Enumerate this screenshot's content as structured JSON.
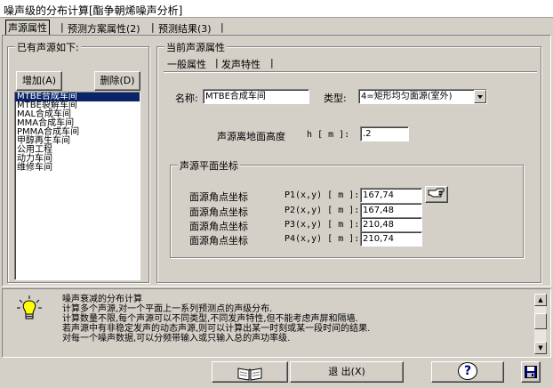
{
  "window": {
    "title": "噪声级的分布计算[酯争朝烯噪声分析]"
  },
  "tabs": [
    {
      "label": "声源属性"
    },
    {
      "label": "预测方案属性(2)"
    },
    {
      "label": "预测结果(3)"
    }
  ],
  "left": {
    "group_title": "已有声源如下:",
    "add_button": "增加(A)",
    "delete_button": "删除(D)",
    "sources": [
      "MTBE合成车间",
      "MTBE裂解车间",
      "MAL合成车间",
      "MMA合成车间",
      "PMMA合成车间",
      "甲醇再生车间",
      "公用工程",
      "动力车间",
      "维修车间"
    ],
    "selected_index": 0
  },
  "right": {
    "group_title": "当前声源属性",
    "subtabs": [
      "一般属性",
      "发声特性"
    ],
    "name_label": "名称:",
    "name_value": "MTBE合成车间",
    "type_label": "类型:",
    "type_value": "4=矩形均匀面源(室外)",
    "height_label": "声源离地面高度",
    "height_unit": "h [ m ]:",
    "height_value": ".2",
    "coords": {
      "group_title": "声源平面坐标",
      "rows": [
        {
          "label": "面源角点坐标",
          "unit": "P1(x,y) [ m ]:",
          "value": "167,74"
        },
        {
          "label": "面源角点坐标",
          "unit": "P2(x,y) [ m ]:",
          "value": "167,48"
        },
        {
          "label": "面源角点坐标",
          "unit": "P3(x,y) [ m ]:",
          "value": "210,48"
        },
        {
          "label": "面源角点坐标",
          "unit": "P4(x,y) [ m ]:",
          "value": "210,74"
        }
      ]
    }
  },
  "info": {
    "lines": [
      "噪声衰减的分布计算",
      "计算多个声源,对一个平面上一系列预测点的声级分布.",
      "计算数量不限,每个声源可以不同类型,不同发声特性,但不能考虑声屏和隔墙.",
      "若声源中有非稳定发声的动态声源,则可以计算出某一时刻或某一段时间的结果.",
      "对每一个噪声数据,可以分频带输入或只输入总的声功率级."
    ]
  },
  "bottom": {
    "exit_button": "退 出(X)",
    "help_label": "?"
  }
}
